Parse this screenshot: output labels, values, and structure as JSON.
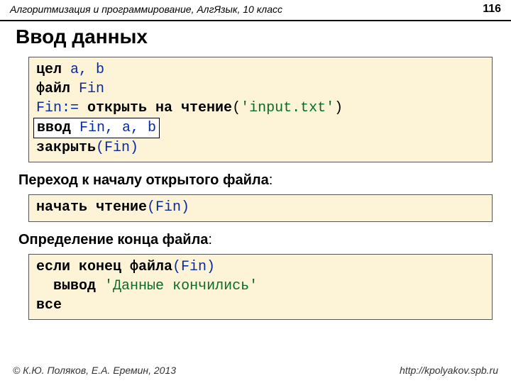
{
  "header": {
    "title": "Алгоритмизация и программирование, АлгЯзык, 10 класс",
    "page": "116"
  },
  "title": "Ввод данных",
  "code1": {
    "l1_kw": "цел",
    "l1_rest": " a, b",
    "l2_kw": "файл",
    "l2_rest": " Fin",
    "l3_a": "Fin:= ",
    "l3_kw": "открыть на чтение",
    "l3_p1": "(",
    "l3_str": "'input.txt'",
    "l3_p2": ")",
    "l4_kw": "ввод",
    "l4_rest": " Fin, a, b",
    "l5_kw": "закрыть",
    "l5_rest": "(Fin)"
  },
  "sub1": {
    "label": "Переход к началу открытого файла",
    "colon": ":"
  },
  "code2": {
    "kw": "начать чтение",
    "rest": "(Fin)"
  },
  "sub2": {
    "label": "Определение конца файла",
    "colon": ":"
  },
  "code3": {
    "l1_kw": "если",
    "l1_fn": " конец файла",
    "l1_rest": "(Fin)",
    "l2_ind": "  ",
    "l2_kw": "вывод",
    "l2_sp": " ",
    "l2_str": "'Данные кончились'",
    "l3_kw": "все"
  },
  "footer": {
    "copyright": "© К.Ю. Поляков, Е.А. Еремин, 2013",
    "url": "http://kpolyakov.spb.ru"
  }
}
